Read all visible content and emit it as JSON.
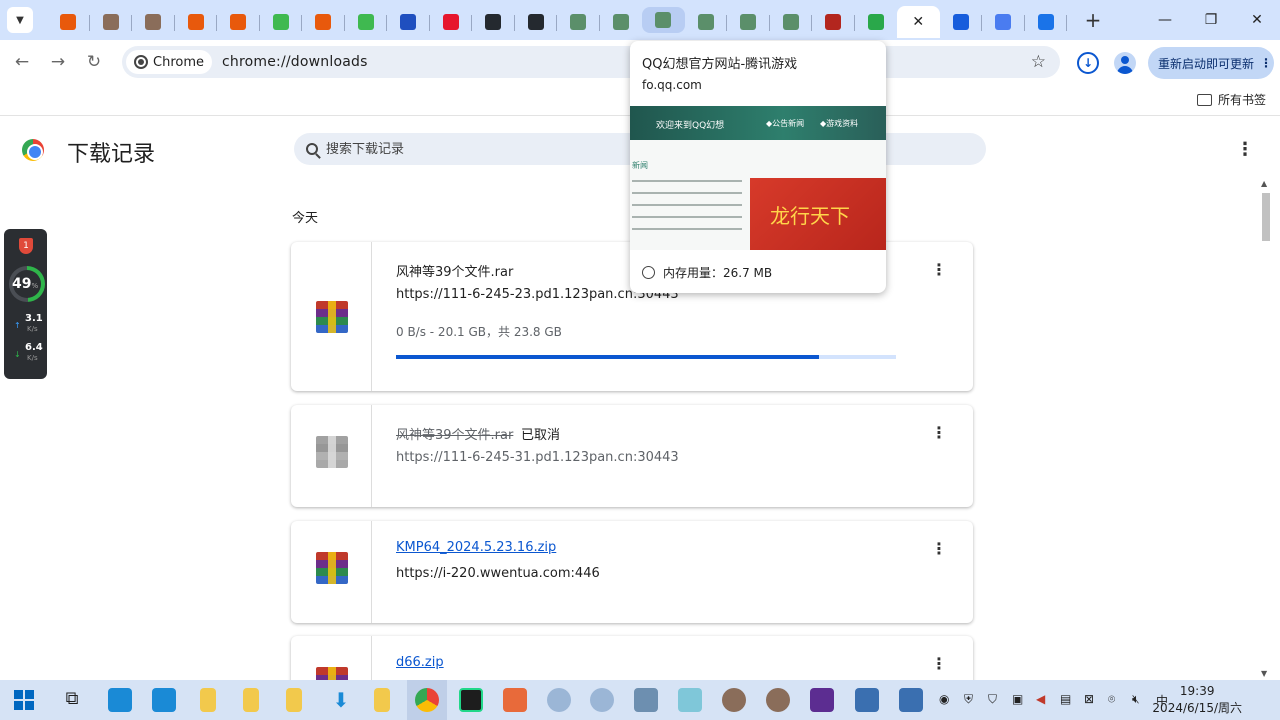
{
  "tabs": [
    {
      "name": "tab-fav-orange-1",
      "color": "#e8590c",
      "icon": "orange-flag-icon"
    },
    {
      "name": "tab-fav-game-1",
      "color": "#8a6d5a",
      "icon": "game-icon"
    },
    {
      "name": "tab-fav-game-2",
      "color": "#8a6d5a",
      "icon": "game-icon"
    },
    {
      "name": "tab-fav-orange-2",
      "color": "#e8590c",
      "icon": "orange-flag-icon"
    },
    {
      "name": "tab-fav-orange-3",
      "color": "#e8590c",
      "icon": "orange-flag-icon"
    },
    {
      "name": "tab-fav-green-1",
      "color": "#3fb950",
      "icon": "green-icon"
    },
    {
      "name": "tab-fav-orange-4",
      "color": "#e8590c",
      "icon": "orange-flag-icon"
    },
    {
      "name": "tab-fav-green-2",
      "color": "#3fb950",
      "icon": "green-icon"
    },
    {
      "name": "tab-fav-blue",
      "color": "#1f4fbf",
      "icon": "blue-icon"
    },
    {
      "name": "tab-fav-weibo",
      "color": "#e6162d",
      "icon": "weibo-icon"
    },
    {
      "name": "tab-fav-github-1",
      "color": "#24292f",
      "icon": "github-icon"
    },
    {
      "name": "tab-fav-github-2",
      "color": "#24292f",
      "icon": "github-icon"
    },
    {
      "name": "tab-fav-qq-1",
      "color": "#5b8f6a",
      "icon": "qq-game-icon"
    },
    {
      "name": "tab-fav-qq-2",
      "color": "#5b8f6a",
      "icon": "qq-game-icon"
    },
    {
      "name": "tab-fav-qq-3",
      "color": "#5b8f6a",
      "icon": "qq-game-icon",
      "hover": true
    },
    {
      "name": "tab-fav-qq-4",
      "color": "#5b8f6a",
      "icon": "qq-game-icon"
    },
    {
      "name": "tab-fav-qq-5",
      "color": "#5b8f6a",
      "icon": "qq-game-icon"
    },
    {
      "name": "tab-fav-qq-6",
      "color": "#5b8f6a",
      "icon": "qq-game-icon"
    },
    {
      "name": "tab-fav-red",
      "color": "#b3261e",
      "icon": "red-logo-icon"
    },
    {
      "name": "tab-fav-green-3",
      "color": "#2aa84a",
      "icon": "green-app-icon"
    },
    {
      "name": "tab-downloads",
      "active": true,
      "icon": "close-icon"
    },
    {
      "name": "tab-fav-bitwarden",
      "color": "#175ddc",
      "icon": "shield-icon"
    },
    {
      "name": "tab-fav-123",
      "color": "#4a7cf0",
      "icon": "numbers-icon"
    },
    {
      "name": "tab-fav-settings",
      "color": "#1a73e8",
      "icon": "gear-icon"
    }
  ],
  "toolbar": {
    "chip_label": "Chrome",
    "url": "chrome://downloads",
    "update_label": "重新启动即可更新"
  },
  "bookmarks": {
    "all_label": "所有书签"
  },
  "downloads": {
    "title": "下载记录",
    "search_placeholder": "搜索下载记录",
    "section_today": "今天",
    "items": [
      {
        "file": "风神等39个文件.rar",
        "source": "https://111-6-245-23.pd1.123pan.cn:30443",
        "progress_text": "0 B/s - 20.1 GB，共 23.8 GB",
        "progress": 0.845
      },
      {
        "file": "风神等39个文件.rar",
        "status": "已取消",
        "source": "https://111-6-245-31.pd1.123pan.cn:30443"
      },
      {
        "file": "KMP64_2024.5.23.16.zip",
        "source": "https://i-220.wwentua.com:446"
      },
      {
        "file": "d66.zip"
      }
    ]
  },
  "hovercard": {
    "title": "QQ幻想官方网站-腾讯游戏",
    "domain": "fo.qq.com",
    "memory": "内存用量：26.7 MB",
    "preview_banner": "欢迎来到QQ幻想",
    "preview_nav_1": "◆公告新闻",
    "preview_nav_2": "◆游戏资料",
    "preview_news": "新闻",
    "preview_promo": "龙行天下"
  },
  "monitor": {
    "badge": "1",
    "percent": "49",
    "percent_unit": "%",
    "up_rate": "3.1",
    "up_unit": "K/s",
    "down_rate": "6.4",
    "down_unit": "K/s"
  },
  "taskbar": {
    "time": "19:39",
    "date": "2024/6/15/周六",
    "ime": "中"
  }
}
